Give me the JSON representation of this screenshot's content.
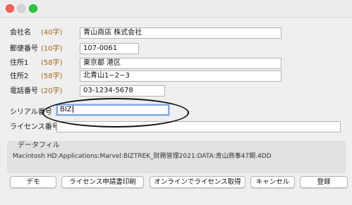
{
  "form": {
    "company": {
      "label": "会社名",
      "hint": "(40字)",
      "value": "青山商店 株式会社"
    },
    "postal": {
      "label": "郵便番号",
      "hint": "(10字)",
      "value": "107-0061"
    },
    "address1": {
      "label": "住所1",
      "hint": "(58字)",
      "value": "東京都 港区"
    },
    "address2": {
      "label": "住所2",
      "hint": "(58字)",
      "value": "北青山1−2−3"
    },
    "phone": {
      "label": "電話番号",
      "hint": "(20字)",
      "value": "03-1234-5678"
    },
    "serial": {
      "label": "シリアル番号",
      "value": "BIZ"
    },
    "license": {
      "label": "ライセンス番号",
      "value": ""
    }
  },
  "datafile": {
    "title": "データフィル",
    "path": "Macintosh HD:Applications:Marvel:BIZTREK_財務管理2021:DATA:青山商事47期.4DD"
  },
  "buttons": {
    "demo": "デモ",
    "print": "ライセンス申請書印刷",
    "online": "オンラインでライセンス取得",
    "cancel": "キャンセル",
    "register": "登録"
  }
}
